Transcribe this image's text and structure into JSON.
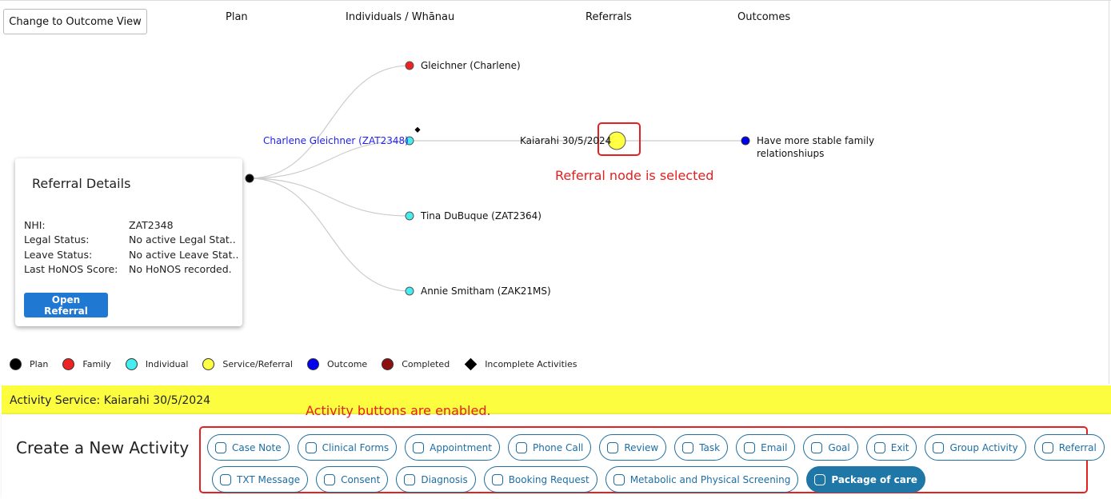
{
  "toolbar": {
    "toggle_label": "Change to Outcome View"
  },
  "columns": [
    "Plan",
    "Individuals / Whānau",
    "Referrals",
    "Outcomes"
  ],
  "tree": {
    "family": "Gleichner (Charlene)",
    "individual_selected": "Charlene Gleichner (ZAT2348)",
    "individual_2": "Tina DuBuque (ZAT2364)",
    "individual_3": "Annie Smitham (ZAK21MS)",
    "referral": "Kaiarahi 30/5/2024",
    "outcome_line1": "Have more stable family",
    "outcome_line2": "relationshiups"
  },
  "annotations": {
    "referral_selected": "Referral node is selected",
    "buttons_enabled": "Activity buttons are enabled."
  },
  "card": {
    "title": "Referral Details",
    "rows": [
      {
        "label": "NHI:",
        "value": "ZAT2348"
      },
      {
        "label": "Legal Status:",
        "value": "No active Legal Stat.."
      },
      {
        "label": "Leave Status:",
        "value": "No active Leave Stat.."
      },
      {
        "label": "Last HoNOS Score:",
        "value": "No HoNOS recorded."
      }
    ],
    "button": "Open Referral"
  },
  "legend": [
    {
      "label": "Plan",
      "color": "#000000"
    },
    {
      "label": "Family",
      "color": "#ee2222"
    },
    {
      "label": "Individual",
      "color": "#44eeee"
    },
    {
      "label": "Service/Referral",
      "color": "#ffff44"
    },
    {
      "label": "Outcome",
      "color": "#0000ee"
    },
    {
      "label": "Completed",
      "color": "#8b1010"
    },
    {
      "label": "Incomplete Activities",
      "shape": "diamond"
    }
  ],
  "activity_service": "Activity Service: Kaiarahi 30/5/2024",
  "create_title": "Create a New Activity",
  "buttons_row1": [
    {
      "label": "Case Note",
      "icon": "note-icon"
    },
    {
      "label": "Clinical Forms",
      "icon": "clipboard-icon"
    },
    {
      "label": "Appointment",
      "icon": "calendar-clock-icon"
    },
    {
      "label": "Phone Call",
      "icon": "phone-icon"
    },
    {
      "label": "Review",
      "icon": "document-search-icon"
    },
    {
      "label": "Task",
      "icon": "task-list-icon"
    },
    {
      "label": "Email",
      "icon": "mail-icon"
    },
    {
      "label": "Goal",
      "icon": "ribbon-icon"
    },
    {
      "label": "Exit",
      "icon": "arrow-left-circle-icon"
    },
    {
      "label": "Group Activity",
      "icon": "people-group-icon"
    },
    {
      "label": "Referral",
      "icon": "person-add-icon"
    }
  ],
  "buttons_row2": [
    {
      "label": "TXT Message",
      "icon": "chat-icon"
    },
    {
      "label": "Consent",
      "icon": "thumbs-up-icon"
    },
    {
      "label": "Diagnosis",
      "icon": "stethoscope-icon"
    },
    {
      "label": "Booking Request",
      "icon": "calendar-clock-icon"
    },
    {
      "label": "Metabolic and Physical Screening",
      "icon": "heart-pulse-icon"
    },
    {
      "label": "Package of care",
      "icon": "box-icon",
      "active": true
    }
  ]
}
